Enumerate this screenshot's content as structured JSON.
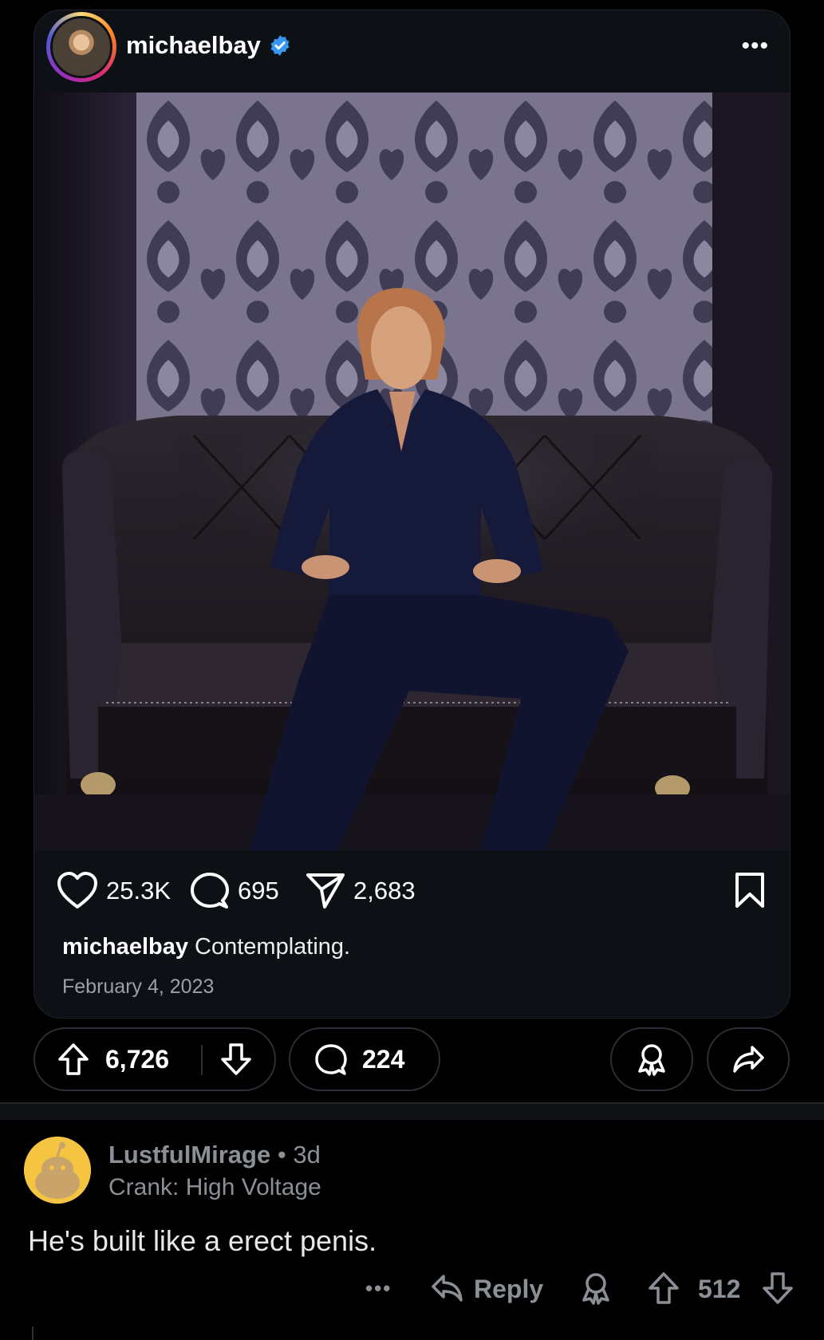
{
  "instagram_post": {
    "username": "michaelbay",
    "more_icon": "more-dots-icon",
    "stats": {
      "likes": "25.3K",
      "comments": "695",
      "shares": "2,683"
    },
    "caption_user": "michaelbay",
    "caption_text": "Contemplating.",
    "date": "February 4, 2023"
  },
  "reddit_post": {
    "upvotes": "6,726",
    "comments": "224"
  },
  "comment": {
    "username": "LustfulMirage",
    "separator": "•",
    "age": "3d",
    "flair": "Crank: High Voltage",
    "body": "He's built like a erect penis.",
    "more_icon": "•••",
    "reply_label": "Reply",
    "score": "512"
  },
  "colors": {
    "background": "#000000",
    "card": "#0d1014",
    "muted_text": "#8b8f96",
    "verified_blue": "#3897f0",
    "snoo_avatar": "#f5c542"
  }
}
